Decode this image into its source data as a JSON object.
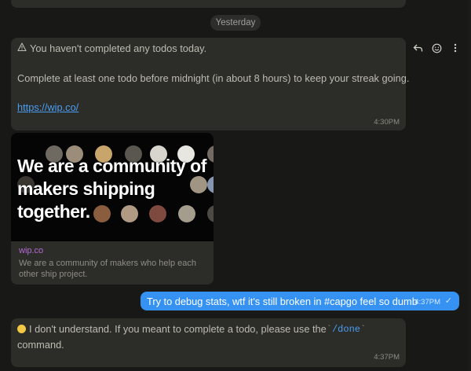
{
  "date_separator": "Yesterday",
  "messages": [
    {
      "warning_text": "You haven't completed any todos today.",
      "body": "Complete at least one todo before midnight (in about 8 hours) to keep your streak going.",
      "link": "https://wip.co/",
      "time": "4:30PM"
    }
  ],
  "link_preview": {
    "banner_title": "We are a community of makers shipping together.",
    "site": "wip.co",
    "description": "We are a community of makers who help each other ship project."
  },
  "outgoing": {
    "text": "Try to debug stats, wtf it's still broken in #capgo feel so dumb",
    "time": "4:37PM",
    "status": "✓"
  },
  "reply": {
    "line1_prefix": "I don't understand. If you meant to complete a todo, please use the ",
    "tick_open": "`",
    "command": "/done",
    "tick_close": "`",
    "line2": "command.",
    "time": "4:37PM"
  },
  "icons": {
    "warning": "warning-triangle-icon",
    "reply": "reply-icon",
    "react": "smiley-icon",
    "more": "more-vertical-icon"
  },
  "colors": {
    "background": "#181817",
    "bubble_in": "#2c2c28",
    "bubble_out": "#3592f3",
    "link": "#4a9ff5",
    "site": "#b36bd6"
  }
}
